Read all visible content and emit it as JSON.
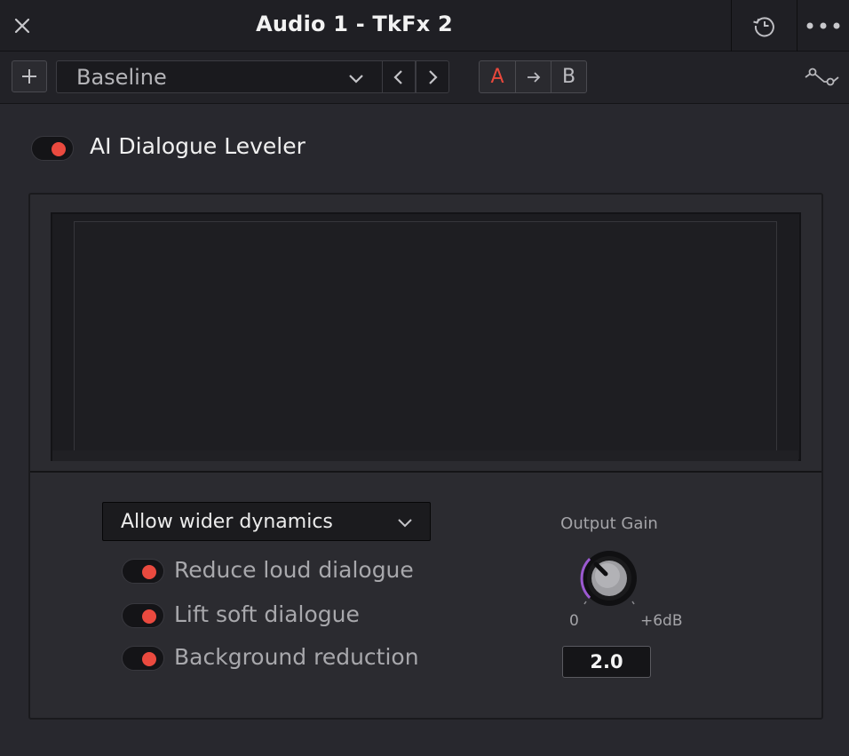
{
  "window": {
    "title": "Audio 1 - TkFx 2",
    "icons": {
      "close": "close-icon",
      "history": "reset-history-icon",
      "more": "more-icon"
    }
  },
  "toolbar": {
    "add_icon": "plus-icon",
    "preset": "Baseline",
    "ab": {
      "a": "A",
      "arrow": "arrow-right-icon",
      "b": "B"
    },
    "curve_icon": "automation-curve-icon"
  },
  "plugin": {
    "name": "AI Dialogue Leveler",
    "enabled": true
  },
  "controls": {
    "mode": "Allow wider dynamics",
    "options": [
      {
        "label": "Reduce loud dialogue",
        "on": true
      },
      {
        "label": "Lift soft dialogue",
        "on": true
      },
      {
        "label": "Background reduction",
        "on": true
      }
    ],
    "output_gain": {
      "label": "Output Gain",
      "min_label": "0",
      "max_label": "+6dB",
      "value": "2.0"
    }
  },
  "colors": {
    "accent_red": "#ea4a3f",
    "knob_arc": "#9b59d0",
    "background": "#28282e"
  }
}
